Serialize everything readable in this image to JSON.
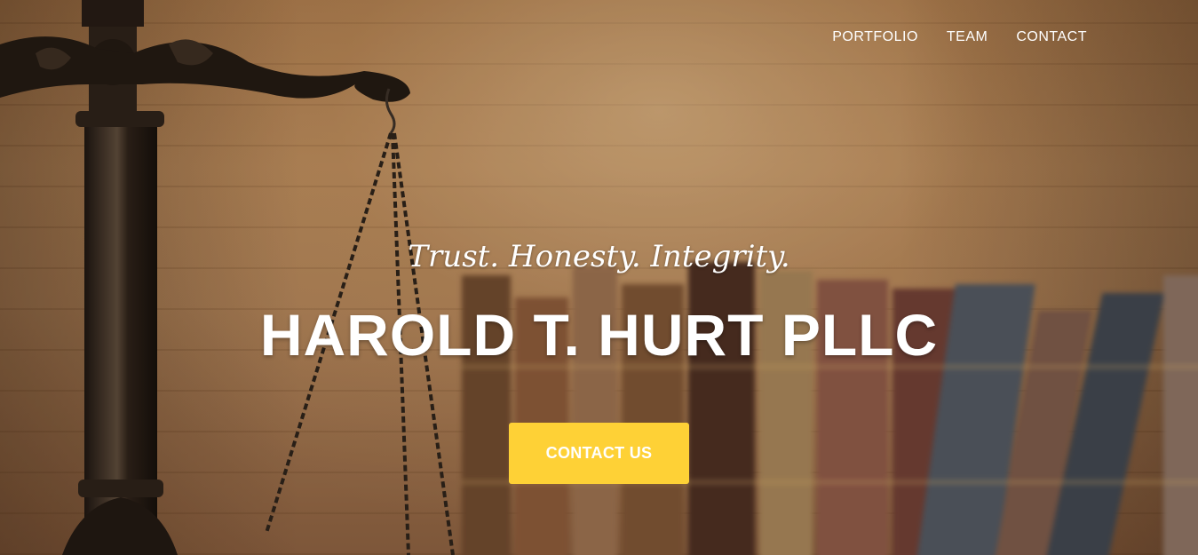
{
  "nav": {
    "items": [
      {
        "label": "PORTFOLIO"
      },
      {
        "label": "TEAM"
      },
      {
        "label": "CONTACT"
      }
    ]
  },
  "hero": {
    "tagline": "Trust. Honesty. Integrity.",
    "firm_name": "HAROLD T. HURT PLLC",
    "cta_label": "CONTACT US",
    "background_image": "scales-of-justice-and-books-photo"
  },
  "colors": {
    "accent": "#fed136",
    "text": "#ffffff"
  }
}
